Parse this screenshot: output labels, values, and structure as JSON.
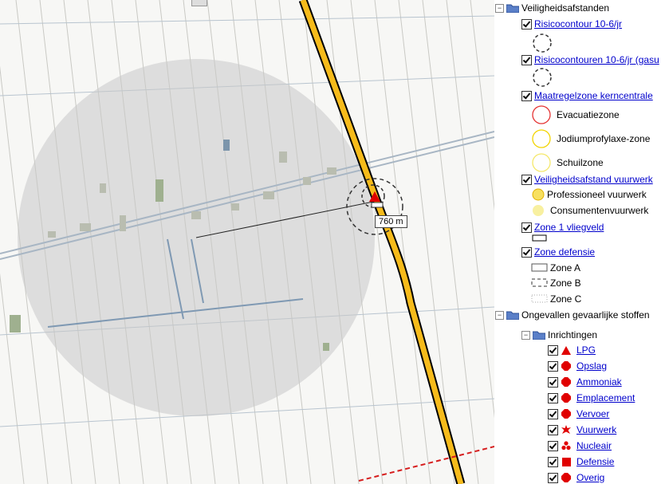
{
  "map": {
    "scale_label": "760 m"
  },
  "legend": {
    "group1": {
      "label": "Veiligheidsafstanden",
      "layers": [
        {
          "label": "Risicocontour 10-6/jr"
        },
        {
          "label": "Risicocontouren 10-6/jr (gasu"
        },
        {
          "label": "Maatregelzone kerncentrale",
          "items": [
            "Evacuatiezone",
            "Jodiumprofylaxe-zone",
            "Schuilzone"
          ]
        },
        {
          "label": "Veiligheidsafstand vuurwerk",
          "items": [
            "Professioneel vuurwerk",
            "Consumentenvuurwerk"
          ]
        },
        {
          "label": "Zone 1 vliegveld"
        },
        {
          "label": "Zone defensie",
          "items": [
            "Zone A",
            "Zone B",
            "Zone C"
          ]
        }
      ]
    },
    "group2": {
      "label": "Ongevallen gevaarlijke stoffen",
      "subgroup": {
        "label": "Inrichtingen",
        "items": [
          "LPG",
          "Opslag",
          "Ammoniak",
          "Emplacement",
          "Vervoer",
          "Vuurwerk",
          "Nucleair",
          "Defensie",
          "Overig"
        ]
      }
    },
    "colors": {
      "link": "#0000cc",
      "evacuatie": "#e53333",
      "jodium": "#f2d400",
      "schuil": "#f5e86a",
      "marker_red": "#e00000"
    }
  }
}
